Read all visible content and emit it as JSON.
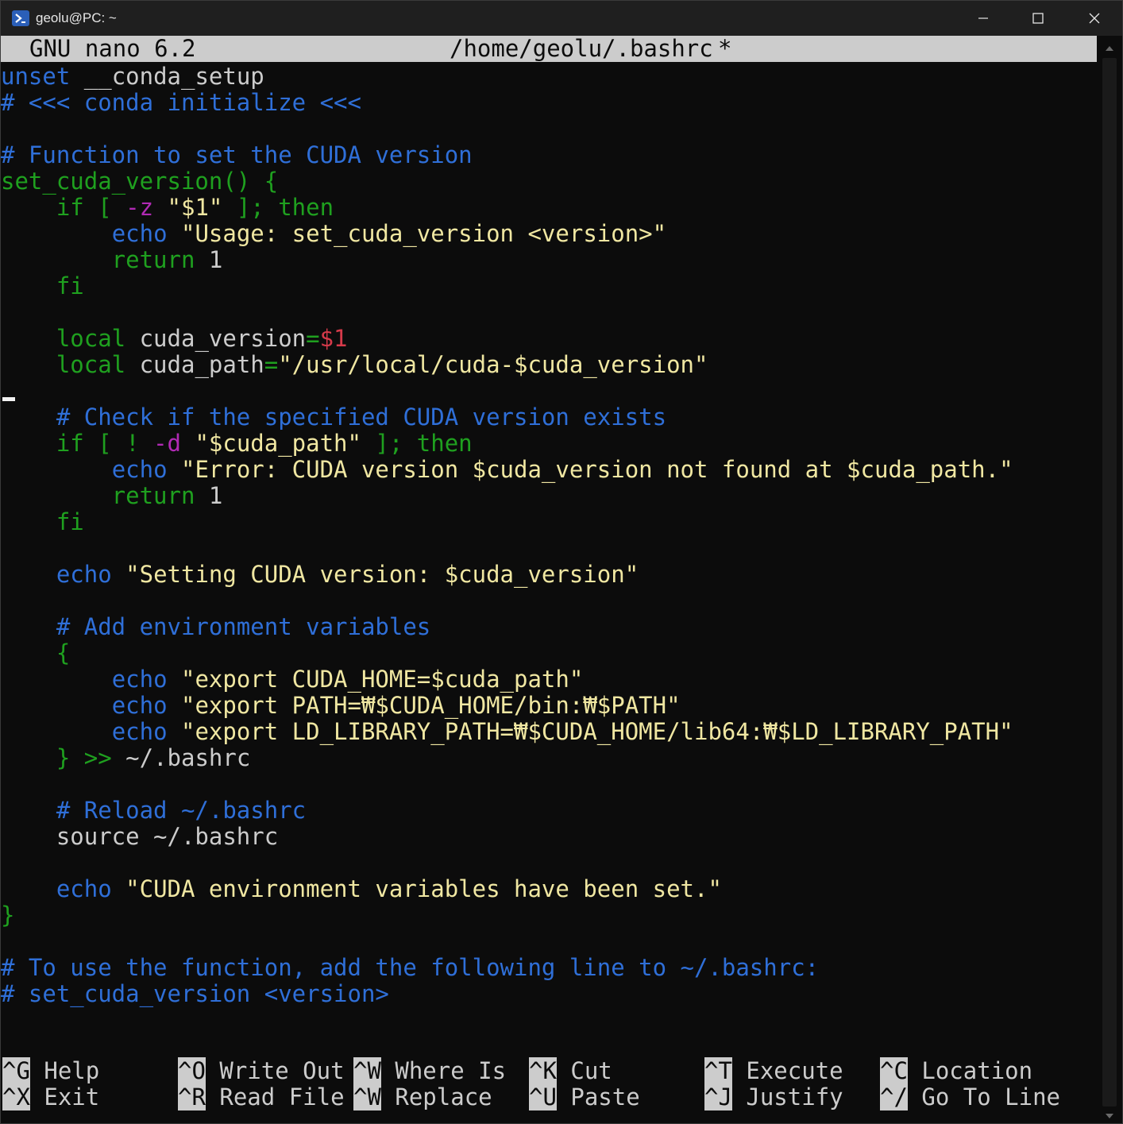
{
  "window": {
    "title": "geolu@PC: ~",
    "icons": {
      "app": "powershell-icon",
      "minimize": "minimize-icon",
      "maximize": "maximize-icon",
      "close": "close-icon"
    }
  },
  "nano": {
    "version": "GNU nano 6.2",
    "filename": "/home/geolu/.bashrc",
    "modified": "*"
  },
  "colors": {
    "comment": "#2f6fd8",
    "keyword": "#1fa01f",
    "string": "#f0e7a2",
    "variable": "#d63a4a",
    "flag": "#b12ab5",
    "header_bg": "#cccccc",
    "background": "#0c0c0c"
  },
  "editor": {
    "lines": [
      [
        {
          "t": "unset",
          "c": "blue"
        },
        {
          "t": " __conda_setup",
          "c": "plain"
        }
      ],
      [
        {
          "t": "# <<< conda initialize <<<",
          "c": "blue"
        }
      ],
      [],
      [
        {
          "t": "# Function to set the CUDA version",
          "c": "blue"
        }
      ],
      [
        {
          "t": "set_cuda_version() {",
          "c": "green"
        }
      ],
      [
        {
          "t": "    if [ ",
          "c": "green"
        },
        {
          "t": "-z",
          "c": "mag"
        },
        {
          "t": " \"$1\"",
          "c": "yellow"
        },
        {
          "t": " ]; then",
          "c": "green"
        }
      ],
      [
        {
          "t": "        ",
          "c": "plain"
        },
        {
          "t": "echo",
          "c": "blue"
        },
        {
          "t": " \"Usage: set_cuda_version <version>\"",
          "c": "yellow"
        }
      ],
      [
        {
          "t": "        return",
          "c": "green"
        },
        {
          "t": " 1",
          "c": "plain"
        }
      ],
      [
        {
          "t": "    fi",
          "c": "green"
        }
      ],
      [],
      [
        {
          "t": "    local",
          "c": "green"
        },
        {
          "t": " cuda_version",
          "c": "plain"
        },
        {
          "t": "=",
          "c": "green"
        },
        {
          "t": "$1",
          "c": "red"
        }
      ],
      [
        {
          "t": "    local",
          "c": "green"
        },
        {
          "t": " cuda_path",
          "c": "plain"
        },
        {
          "t": "=",
          "c": "green"
        },
        {
          "t": "\"/usr/local/cuda-$cuda_version\"",
          "c": "yellow"
        }
      ],
      [],
      [
        {
          "t": "    # Check if the specified CUDA version exists",
          "c": "blue"
        }
      ],
      [
        {
          "t": "    if [ ! ",
          "c": "green"
        },
        {
          "t": "-d",
          "c": "mag"
        },
        {
          "t": " \"$cuda_path\"",
          "c": "yellow"
        },
        {
          "t": " ]; then",
          "c": "green"
        }
      ],
      [
        {
          "t": "        ",
          "c": "plain"
        },
        {
          "t": "echo",
          "c": "blue"
        },
        {
          "t": " \"Error: CUDA version $cuda_version not found at $cuda_path.\"",
          "c": "yellow"
        }
      ],
      [
        {
          "t": "        return",
          "c": "green"
        },
        {
          "t": " 1",
          "c": "plain"
        }
      ],
      [
        {
          "t": "    fi",
          "c": "green"
        }
      ],
      [],
      [
        {
          "t": "    ",
          "c": "plain"
        },
        {
          "t": "echo",
          "c": "blue"
        },
        {
          "t": " \"Setting CUDA version: $cuda_version\"",
          "c": "yellow"
        }
      ],
      [],
      [
        {
          "t": "    # Add environment variables",
          "c": "blue"
        }
      ],
      [
        {
          "t": "    {",
          "c": "green"
        }
      ],
      [
        {
          "t": "        ",
          "c": "plain"
        },
        {
          "t": "echo",
          "c": "blue"
        },
        {
          "t": " \"export CUDA_HOME=$cuda_path\"",
          "c": "yellow"
        }
      ],
      [
        {
          "t": "        ",
          "c": "plain"
        },
        {
          "t": "echo",
          "c": "blue"
        },
        {
          "t": " \"export PATH=₩$CUDA_HOME/bin:₩$PATH\"",
          "c": "yellow"
        }
      ],
      [
        {
          "t": "        ",
          "c": "plain"
        },
        {
          "t": "echo",
          "c": "blue"
        },
        {
          "t": " \"export LD_LIBRARY_PATH=₩$CUDA_HOME/lib64:₩$LD_LIBRARY_PATH\"",
          "c": "yellow"
        }
      ],
      [
        {
          "t": "    } >>",
          "c": "green"
        },
        {
          "t": " ~/.bashrc",
          "c": "plain"
        }
      ],
      [],
      [
        {
          "t": "    # Reload ~/.bashrc",
          "c": "blue"
        }
      ],
      [
        {
          "t": "    source ~/.bashrc",
          "c": "plain"
        }
      ],
      [],
      [
        {
          "t": "    ",
          "c": "plain"
        },
        {
          "t": "echo",
          "c": "blue"
        },
        {
          "t": " \"CUDA environment variables have been set.\"",
          "c": "yellow"
        }
      ],
      [
        {
          "t": "}",
          "c": "green"
        }
      ],
      [],
      [
        {
          "t": "# To use the function, add the following line to ~/.bashrc:",
          "c": "blue"
        }
      ],
      [
        {
          "t": "# set_cuda_version <version>",
          "c": "blue"
        }
      ]
    ]
  },
  "shortcuts": [
    {
      "key": "^G",
      "label": "Help"
    },
    {
      "key": "^X",
      "label": "Exit"
    },
    {
      "key": "^O",
      "label": "Write Out"
    },
    {
      "key": "^R",
      "label": "Read File"
    },
    {
      "key": "^W",
      "label": "Where Is"
    },
    {
      "key": "^W",
      "label": "Replace"
    },
    {
      "key": "^K",
      "label": "Cut"
    },
    {
      "key": "^U",
      "label": "Paste"
    },
    {
      "key": "^T",
      "label": "Execute"
    },
    {
      "key": "^J",
      "label": "Justify"
    },
    {
      "key": "^C",
      "label": "Location"
    },
    {
      "key": "^/",
      "label": "Go To Line"
    }
  ]
}
